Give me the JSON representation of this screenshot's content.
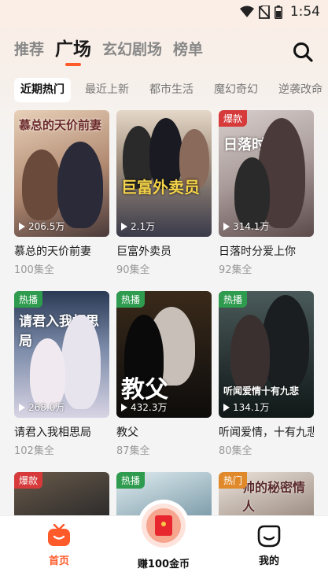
{
  "status": {
    "time": "1:54"
  },
  "top_tabs": [
    {
      "label": "推荐",
      "active": false
    },
    {
      "label": "广场",
      "active": true
    },
    {
      "label": "玄幻剧场",
      "active": false
    },
    {
      "label": "榜单",
      "active": false
    }
  ],
  "sub_tabs": [
    {
      "label": "近期热门",
      "active": true
    },
    {
      "label": "最近上新",
      "active": false
    },
    {
      "label": "都市生活",
      "active": false
    },
    {
      "label": "魔幻奇幻",
      "active": false
    },
    {
      "label": "逆袭改命",
      "active": false
    }
  ],
  "dramas": [
    {
      "title": "慕总的天价前妻",
      "episodes": "100集全",
      "views": "206.5万",
      "badge": "",
      "cover_text": "慕总的天价前妻",
      "colors": [
        "#c9a98a",
        "#5b4a4a"
      ]
    },
    {
      "title": "巨富外卖员",
      "episodes": "90集全",
      "views": "2.1万",
      "badge": "",
      "cover_text": "巨富外卖员",
      "colors": [
        "#d8c9b9",
        "#3a4a6a"
      ]
    },
    {
      "title": "日落时分爱上你",
      "episodes": "92集全",
      "views": "314.1万",
      "badge": "爆款",
      "cover_text": "日落时分",
      "colors": [
        "#cfc3c0",
        "#7a6a6a"
      ]
    },
    {
      "title": "请君入我相思局",
      "episodes": "102集全",
      "views": "268.0万",
      "badge": "热播",
      "cover_text": "请君入我相思局",
      "colors": [
        "#3c4a66",
        "#c8c4d8"
      ]
    },
    {
      "title": "教父",
      "episodes": "87集全",
      "views": "432.3万",
      "badge": "热播",
      "cover_text": "教父",
      "colors": [
        "#4a3a2a",
        "#1a1a1a"
      ]
    },
    {
      "title": "听闻爱情，十有九悲",
      "episodes": "80集全",
      "views": "134.1万",
      "badge": "热播",
      "cover_text": "听闻爱情十有九悲",
      "colors": [
        "#2a3a3a",
        "#6a7a7a"
      ]
    },
    {
      "title": "",
      "episodes": "",
      "views": "",
      "badge": "爆款",
      "cover_text": "",
      "colors": [
        "#5a4a3a",
        "#2a2a2a"
      ]
    },
    {
      "title": "",
      "episodes": "",
      "views": "",
      "badge": "热播",
      "cover_text": "",
      "colors": [
        "#d0e0e8",
        "#5a7a8a"
      ]
    },
    {
      "title": "",
      "episodes": "",
      "views": "",
      "badge": "热门",
      "cover_text": "帅的秘密情人",
      "colors": [
        "#e0d8d0",
        "#8a7a70"
      ]
    }
  ],
  "bottom_nav": {
    "home": "首页",
    "earn": "赚100金币",
    "mine": "我的"
  }
}
